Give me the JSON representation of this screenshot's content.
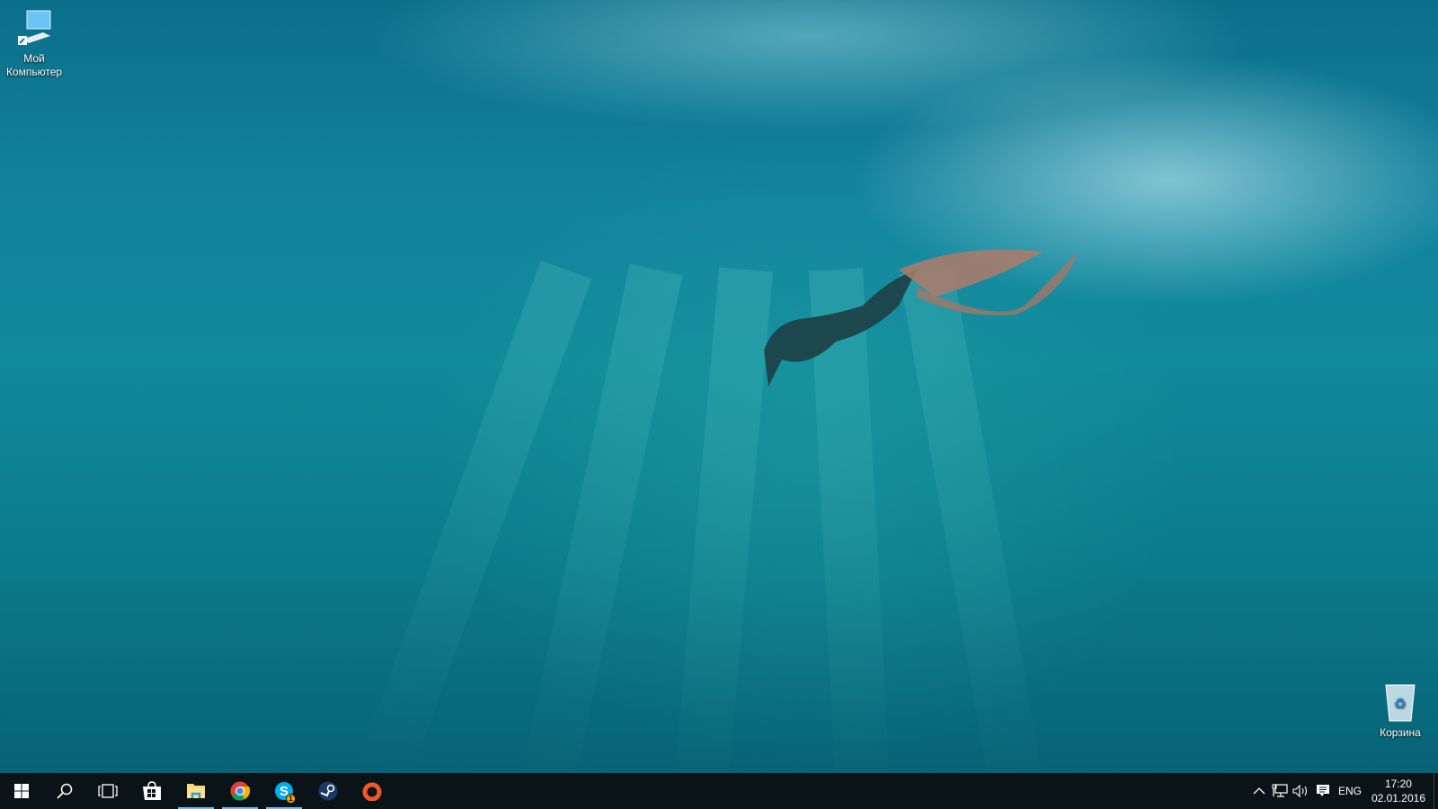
{
  "desktop": {
    "icons": [
      {
        "label_line1": "Мой",
        "label_line2": "Компьютер",
        "icon": "computer-icon"
      },
      {
        "label": "Корзина",
        "icon": "recycle-bin-icon"
      }
    ]
  },
  "taskbar": {
    "buttons": [
      {
        "name": "start",
        "icon": "windows-logo-icon"
      },
      {
        "name": "search",
        "icon": "search-icon"
      },
      {
        "name": "task-view",
        "icon": "task-view-icon"
      },
      {
        "name": "store",
        "icon": "store-icon"
      },
      {
        "name": "file-explorer",
        "icon": "folder-icon",
        "active": true
      },
      {
        "name": "chrome",
        "icon": "chrome-icon",
        "active": true
      },
      {
        "name": "skype",
        "icon": "skype-icon",
        "active": true,
        "badge": "1"
      },
      {
        "name": "steam",
        "icon": "steam-icon"
      },
      {
        "name": "origin",
        "icon": "origin-icon"
      }
    ],
    "tray": {
      "language": "ENG",
      "time": "17:20",
      "date": "02.01.2016"
    },
    "colors": {
      "active_underline": "#76b9ed",
      "badge": "#f6a800"
    }
  }
}
